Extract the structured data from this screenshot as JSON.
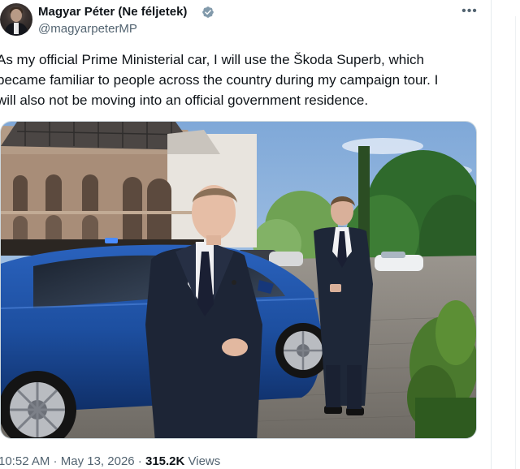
{
  "author": {
    "display_name": "Magyar Péter (Ne féljetek)",
    "handle": "@magyarpeterMP",
    "verified": true
  },
  "tweet": {
    "lines": [
      "As my official Prime Ministerial car, I will use the Škoda Superb, which",
      "became familiar to people across the country during my campaign tour. I",
      "will also not be moving into an official government residence."
    ]
  },
  "meta": {
    "time": "10:52 AM",
    "separator": " · ",
    "date": "May 13, 2026",
    "views_count": "315.2K",
    "views_label": " Views"
  },
  "icons": {
    "more": "more-horizontal-icon",
    "verified": "verified-badge-icon"
  },
  "colors": {
    "text_primary": "#0f1419",
    "text_secondary": "#536471",
    "verified_badge": "#829aab",
    "car_blue": "#1d4fa0"
  }
}
